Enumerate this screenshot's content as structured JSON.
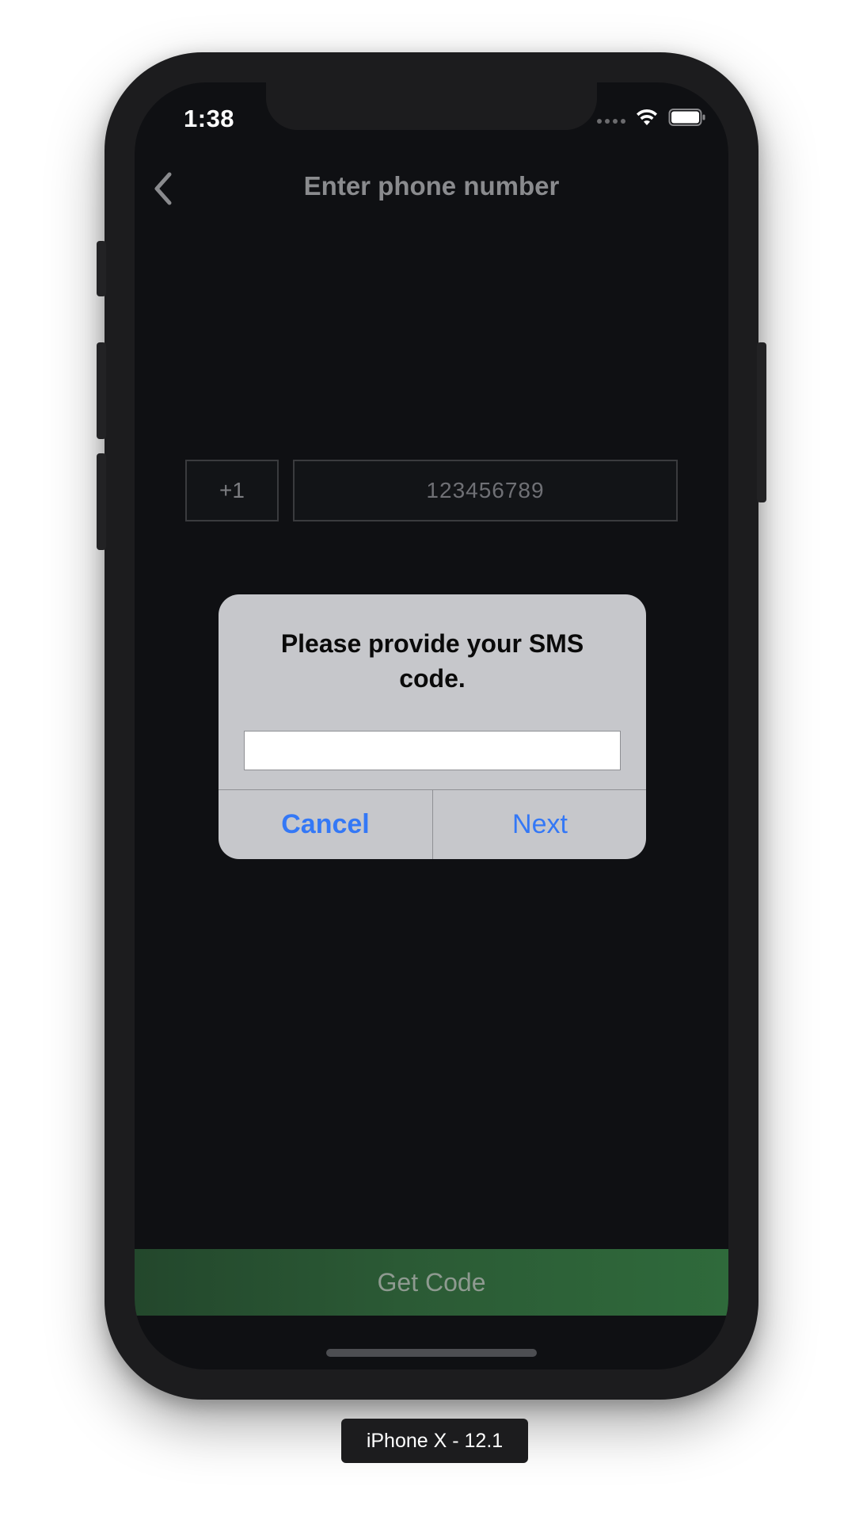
{
  "status_bar": {
    "time": "1:38",
    "icons": [
      "signal-dots-icon",
      "wifi-icon",
      "battery-icon"
    ]
  },
  "nav": {
    "back_icon": "chevron-left-icon",
    "title": "Enter phone number"
  },
  "form": {
    "country_code": "+1",
    "phone_placeholder": "123456789"
  },
  "dialog": {
    "title": "Please provide your SMS code.",
    "input_value": "",
    "cancel_label": "Cancel",
    "next_label": "Next"
  },
  "bottom": {
    "get_code_label": "Get Code"
  },
  "simulator": {
    "label": "iPhone X - 12.1"
  },
  "colors": {
    "background": "#0f1013",
    "accent_blue": "#3478f6",
    "button_green": "#2b5a35",
    "dialog_bg": "#c6c7cb"
  }
}
